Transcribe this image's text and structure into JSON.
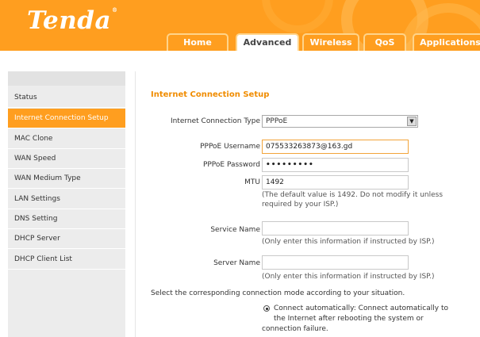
{
  "brand": {
    "name": "Tenda",
    "trademark": "®"
  },
  "nav": {
    "tabs": [
      {
        "label": "Home",
        "active": false
      },
      {
        "label": "Advanced",
        "active": true
      },
      {
        "label": "Wireless",
        "active": false
      },
      {
        "label": "QoS",
        "active": false
      },
      {
        "label": "Applications",
        "active": false
      }
    ]
  },
  "sidebar": {
    "items": [
      {
        "label": "Status",
        "active": false
      },
      {
        "label": "Internet Connection Setup",
        "active": true
      },
      {
        "label": "MAC Clone",
        "active": false
      },
      {
        "label": "WAN Speed",
        "active": false
      },
      {
        "label": "WAN Medium Type",
        "active": false
      },
      {
        "label": "LAN Settings",
        "active": false
      },
      {
        "label": "DNS Setting",
        "active": false
      },
      {
        "label": "DHCP Server",
        "active": false
      },
      {
        "label": "DHCP Client List",
        "active": false
      }
    ]
  },
  "main": {
    "title": "Internet Connection Setup",
    "connection_type": {
      "label": "Internet Connection Type",
      "value": "PPPoE"
    },
    "username": {
      "label": "PPPoE Username",
      "value": "075533263873@163.gd"
    },
    "password": {
      "label": "PPPoE Password",
      "value": "•••••••••"
    },
    "mtu": {
      "label": "MTU",
      "value": "1492",
      "note_line1": "(The default value is 1492. Do not modify it unless",
      "note_line2": "required by your ISP.)"
    },
    "service_name": {
      "label": "Service Name",
      "value": "",
      "note": "(Only enter this information if instructed by ISP.)"
    },
    "server_name": {
      "label": "Server Name",
      "value": "",
      "note": "(Only enter this information if instructed by ISP.)"
    },
    "mode_prompt": "Select the corresponding connection mode according to your situation.",
    "mode_option": {
      "line1": "Connect automatically: Connect automatically to",
      "line2": "the Internet after rebooting the system or",
      "line3": "connection failure.",
      "selected": true
    }
  },
  "colors": {
    "brand_orange": "#ff9e1f",
    "title_orange": "#f08c00",
    "sidebar_bg": "#ececec"
  }
}
